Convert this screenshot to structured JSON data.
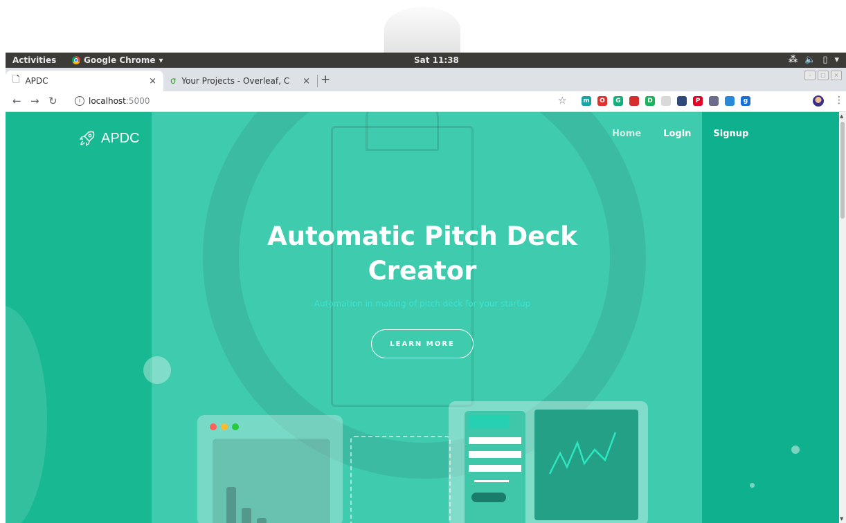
{
  "ubuntu_topbar": {
    "activities": "Activities",
    "app_name": "Google Chrome",
    "app_menu_arrow": "▾",
    "clock": "Sat 11:38",
    "tray_icons": [
      "network-icon",
      "volume-icon",
      "battery-icon",
      "system-menu-icon"
    ]
  },
  "browser": {
    "tabs": [
      {
        "title": "APDC",
        "icon": "page-icon",
        "active": true
      },
      {
        "title": "Your Projects - Overleaf, C",
        "icon": "overleaf-icon",
        "active": false
      }
    ],
    "close_glyph": "×",
    "new_tab_glyph": "+",
    "url_host": "localhost",
    "url_port": ":5000",
    "extension_colors": [
      "#1aa3a3",
      "#e03030",
      "#14b07a",
      "#d62d2d",
      "#1bb35c",
      "#d9d9d9",
      "#2f4a7a",
      "#e60023",
      "#6b6b8a",
      "#2a8ad8",
      "#1a6fd6"
    ],
    "extension_labels": [
      "m",
      "O",
      "G",
      "",
      "D",
      "",
      "",
      "P",
      "",
      "",
      "g"
    ]
  },
  "site": {
    "brand": "APDC",
    "nav": [
      {
        "label": "Home",
        "active": true
      },
      {
        "label": "Login",
        "active": false
      },
      {
        "label": "Signup",
        "active": false
      }
    ],
    "hero_title": "Automatic Pitch Deck Creator",
    "hero_subtitle": "Automation in making of pitch deck for your startup",
    "cta_label": "LEARN MORE"
  },
  "colors": {
    "primary": "#1fbf9f",
    "button_border": "#ffffff",
    "subtitle": "#3fe2d0",
    "spark_line": "#2ee6c0"
  },
  "illustration": {
    "browser_dot_colors": [
      "#ff5f57",
      "#febc2e",
      "#28c840"
    ]
  }
}
